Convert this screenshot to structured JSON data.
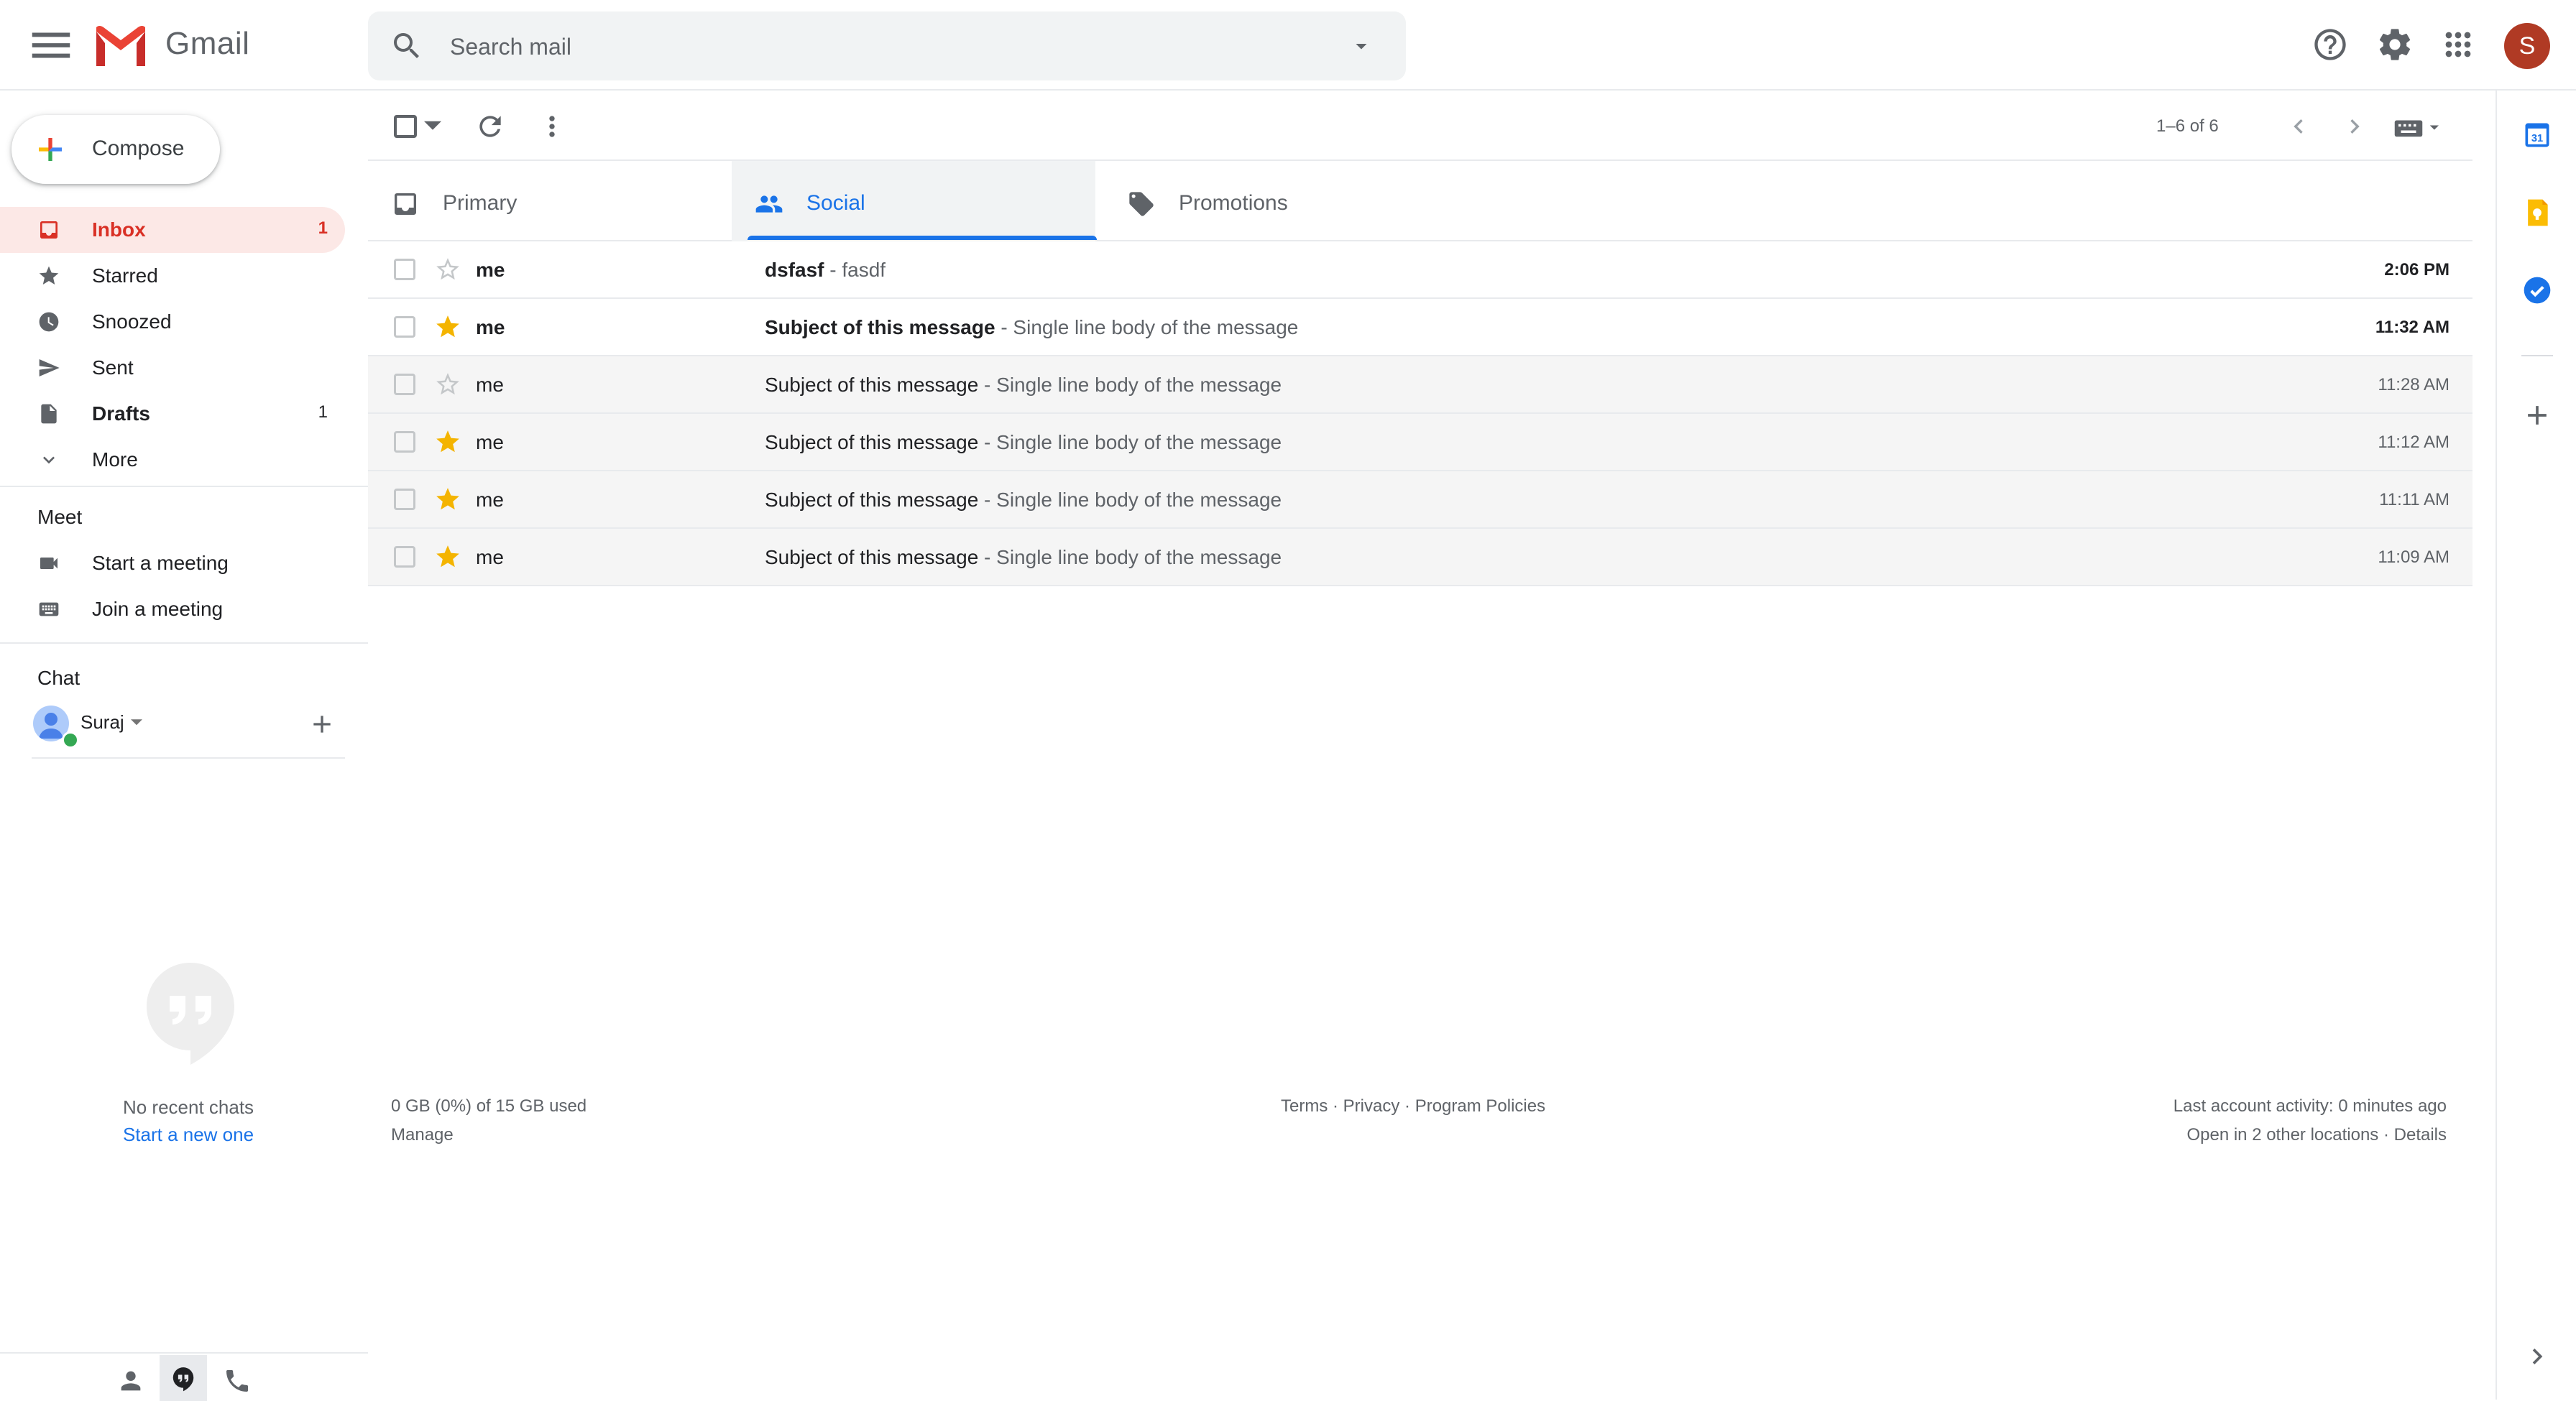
{
  "header": {
    "app_name": "Gmail",
    "search_placeholder": "Search mail",
    "avatar_letter": "S"
  },
  "sidebar": {
    "compose_label": "Compose",
    "items": [
      {
        "label": "Inbox",
        "count": "1",
        "icon": "inbox-icon",
        "bold": true,
        "active": true
      },
      {
        "label": "Starred",
        "count": "",
        "icon": "star-icon"
      },
      {
        "label": "Snoozed",
        "count": "",
        "icon": "clock-icon"
      },
      {
        "label": "Sent",
        "count": "",
        "icon": "send-icon"
      },
      {
        "label": "Drafts",
        "count": "1",
        "icon": "draft-icon",
        "bold": true
      },
      {
        "label": "More",
        "count": "",
        "icon": "chevron-down-icon"
      }
    ],
    "meet": {
      "title": "Meet",
      "items": [
        {
          "label": "Start a meeting",
          "icon": "video-icon"
        },
        {
          "label": "Join a meeting",
          "icon": "keyboard-icon"
        }
      ]
    },
    "chat": {
      "title": "Chat",
      "user_name": "Suraj",
      "no_chats": "No recent chats",
      "start_new": "Start a new one"
    }
  },
  "toolbar": {
    "pagination": "1–6 of 6"
  },
  "tabs": [
    {
      "label": "Primary",
      "icon": "inbox-icon"
    },
    {
      "label": "Social",
      "icon": "people-icon",
      "active": true
    },
    {
      "label": "Promotions",
      "icon": "tag-icon"
    }
  ],
  "messages": [
    {
      "sender": "me",
      "subject": "dsfasf",
      "snippet": " - fasdf",
      "time": "2:06 PM",
      "starred": false,
      "unread": true
    },
    {
      "sender": "me",
      "subject": "Subject of this message",
      "snippet": " - Single line body of the message",
      "time": "11:32 AM",
      "starred": true,
      "unread": true
    },
    {
      "sender": "me",
      "subject": "Subject of this message",
      "snippet": " - Single line body of the message",
      "time": "11:28 AM",
      "starred": false,
      "unread": false
    },
    {
      "sender": "me",
      "subject": "Subject of this message",
      "snippet": " - Single line body of the message",
      "time": "11:12 AM",
      "starred": true,
      "unread": false
    },
    {
      "sender": "me",
      "subject": "Subject of this message",
      "snippet": " - Single line body of the message",
      "time": "11:11 AM",
      "starred": true,
      "unread": false
    },
    {
      "sender": "me",
      "subject": "Subject of this message",
      "snippet": " - Single line body of the message",
      "time": "11:09 AM",
      "starred": true,
      "unread": false
    }
  ],
  "footer": {
    "storage": "0 GB (0%) of 15 GB used",
    "manage": "Manage",
    "terms": "Terms",
    "privacy": "Privacy",
    "policies": "Program Policies",
    "sep": " · ",
    "last_activity": "Last account activity: 0 minutes ago",
    "other_locations": "Open in 2 other locations",
    "details": "Details"
  },
  "colors": {
    "accent": "#1a73e8",
    "inbox_active": "#d93025",
    "inbox_bg": "#fce8e6",
    "star": "#f4b400",
    "avatar": "#b03a24"
  }
}
